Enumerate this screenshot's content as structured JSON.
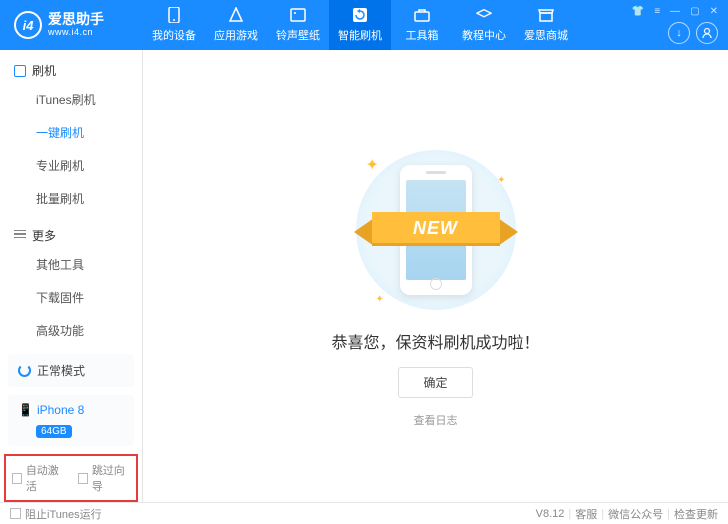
{
  "header": {
    "logo_title": "爱思助手",
    "logo_sub": "www.i4.cn",
    "nav": [
      "我的设备",
      "应用游戏",
      "铃声壁纸",
      "智能刷机",
      "工具箱",
      "教程中心",
      "爱思商城"
    ],
    "active_nav": 3
  },
  "sidebar": {
    "group1_title": "刷机",
    "group1_items": [
      "iTunes刷机",
      "一键刷机",
      "专业刷机",
      "批量刷机"
    ],
    "group1_active": 1,
    "group2_title": "更多",
    "group2_items": [
      "其他工具",
      "下载固件",
      "高级功能"
    ],
    "mode_label": "正常模式",
    "device_name": "iPhone 8",
    "storage": "64GB",
    "checkbox1": "自动激活",
    "checkbox2": "跳过向导"
  },
  "main": {
    "ribbon_text": "NEW",
    "success_msg": "恭喜您，保资料刷机成功啦！",
    "ok_label": "确定",
    "log_link": "查看日志"
  },
  "statusbar": {
    "block_itunes": "阻止iTunes运行",
    "version": "V8.12",
    "svc": "客服",
    "wechat": "微信公众号",
    "update": "检查更新"
  }
}
